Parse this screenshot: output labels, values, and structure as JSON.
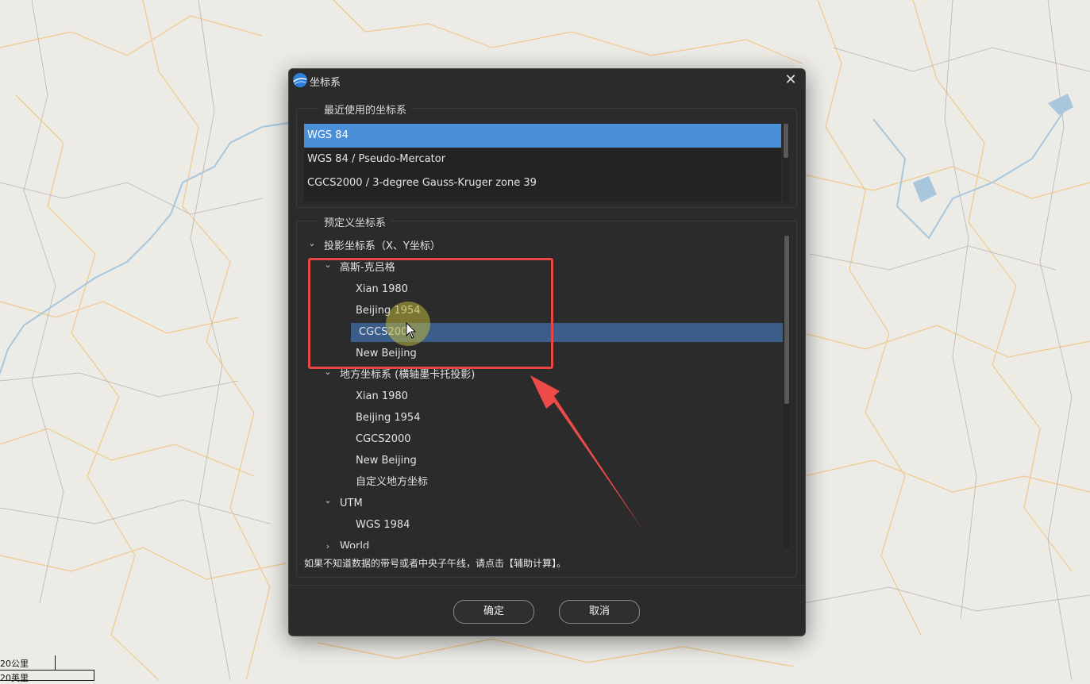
{
  "map": {
    "scale_labels": [
      "20公里",
      "20英里"
    ]
  },
  "dialog": {
    "title": "坐标系",
    "close_glyph": "✕"
  },
  "recent": {
    "group_title": "最近使用的坐标系",
    "items": [
      {
        "label": "WGS 84",
        "selected": true
      },
      {
        "label": "WGS 84 / Pseudo-Mercator",
        "selected": false
      },
      {
        "label": "CGCS2000 / 3-degree Gauss-Kruger zone 39",
        "selected": false
      }
    ]
  },
  "predefined": {
    "group_title": "预定义坐标系",
    "tree": [
      {
        "label": "投影坐标系（X、Y坐标）",
        "level": 0,
        "expanded": true,
        "selected": false
      },
      {
        "label": "高斯-克吕格",
        "level": 1,
        "expanded": true,
        "selected": false
      },
      {
        "label": "Xian 1980",
        "level": 2,
        "selected": false
      },
      {
        "label": "Beijing 1954",
        "level": 2,
        "selected": false
      },
      {
        "label": "CGCS2000",
        "level": 2,
        "selected": true
      },
      {
        "label": "New Beijing",
        "level": 2,
        "selected": false
      },
      {
        "label": "地方坐标系 (横轴墨卡托投影)",
        "level": 1,
        "expanded": true,
        "selected": false
      },
      {
        "label": "Xian 1980",
        "level": 2,
        "selected": false
      },
      {
        "label": "Beijing 1954",
        "level": 2,
        "selected": false
      },
      {
        "label": "CGCS2000",
        "level": 2,
        "selected": false
      },
      {
        "label": "New Beijing",
        "level": 2,
        "selected": false
      },
      {
        "label": "自定义地方坐标",
        "level": 2,
        "selected": false
      },
      {
        "label": "UTM",
        "level": 1,
        "expanded": true,
        "selected": false
      },
      {
        "label": "WGS 1984",
        "level": 2,
        "selected": false
      },
      {
        "label": "World",
        "level": 1,
        "expanded": false,
        "selected": false
      }
    ],
    "hint": "如果不知道数据的带号或者中央子午线，请点击【辅助计算】。"
  },
  "buttons": {
    "ok": "确定",
    "cancel": "取消"
  },
  "colors": {
    "selection_blue": "#4a90d9",
    "tree_selection": "#3b5d8a",
    "annotation_red": "#e84545"
  }
}
